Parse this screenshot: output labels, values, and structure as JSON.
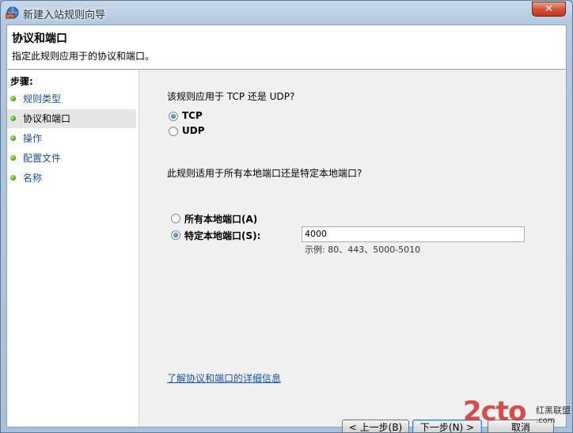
{
  "window": {
    "title": "新建入站规则向导",
    "close_label": "✕"
  },
  "header": {
    "title": "协议和端口",
    "description": "指定此规则应用于的协议和端口。"
  },
  "sidebar": {
    "steps_label": "步骤:",
    "items": [
      {
        "label": "规则类型",
        "current": false
      },
      {
        "label": "协议和端口",
        "current": true
      },
      {
        "label": "操作",
        "current": false
      },
      {
        "label": "配置文件",
        "current": false
      },
      {
        "label": "名称",
        "current": false
      }
    ]
  },
  "protocol": {
    "question": "该规则应用于 TCP 还是 UDP?",
    "options": [
      {
        "label": "TCP",
        "checked": true
      },
      {
        "label": "UDP",
        "checked": false
      }
    ]
  },
  "ports": {
    "question": "此规则适用于所有本地端口还是特定本地端口?",
    "all_label": "所有本地端口(A)",
    "specific_label": "特定本地端口(S):",
    "selected": "specific",
    "value": "4000",
    "example": "示例: 80、443、5000-5010"
  },
  "info_link": "了解协议和端口的详细信息",
  "buttons": {
    "back": "< 上一步(B)",
    "next": "下一步(N) >",
    "cancel": "取消"
  },
  "watermark": {
    "big": "2cto",
    "small": "红黑联盟",
    "url": ".com"
  },
  "colors": {
    "accent": "#1c4f9c",
    "step_dot": "#37a20c"
  }
}
